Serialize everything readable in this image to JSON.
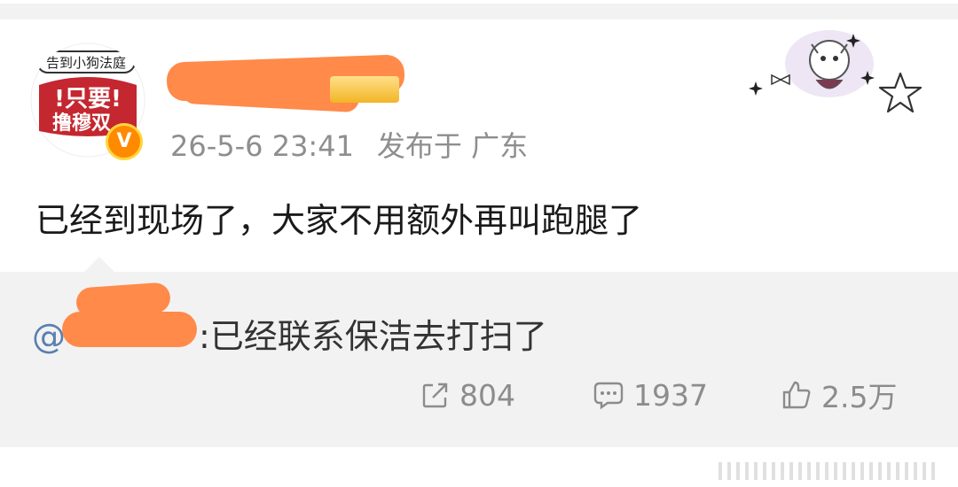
{
  "post": {
    "timestamp": "26-5-6 23:41",
    "location": "发布于 广东",
    "text": "已经到现场了，大家不用额外再叫跑腿了"
  },
  "avatar": {
    "top_text": "告到小狗法庭",
    "main_text": "!只要!",
    "sub_text": "撸穆双",
    "verified_symbol": "V"
  },
  "repost": {
    "mention": "@",
    "text": ":已经联系保洁去打扫了"
  },
  "actions": {
    "repost_count": "804",
    "comment_count": "1937",
    "like_count": "2.5万"
  },
  "colors": {
    "redaction": "#ff8a4a",
    "meta_gray": "#8e8e8e",
    "link_blue": "#5a7fb0",
    "verified_orange": "#ff8a00"
  },
  "icons": [
    "repost-icon",
    "comment-icon",
    "like-icon",
    "star-icon",
    "sparkle-icon",
    "bow-icon"
  ]
}
